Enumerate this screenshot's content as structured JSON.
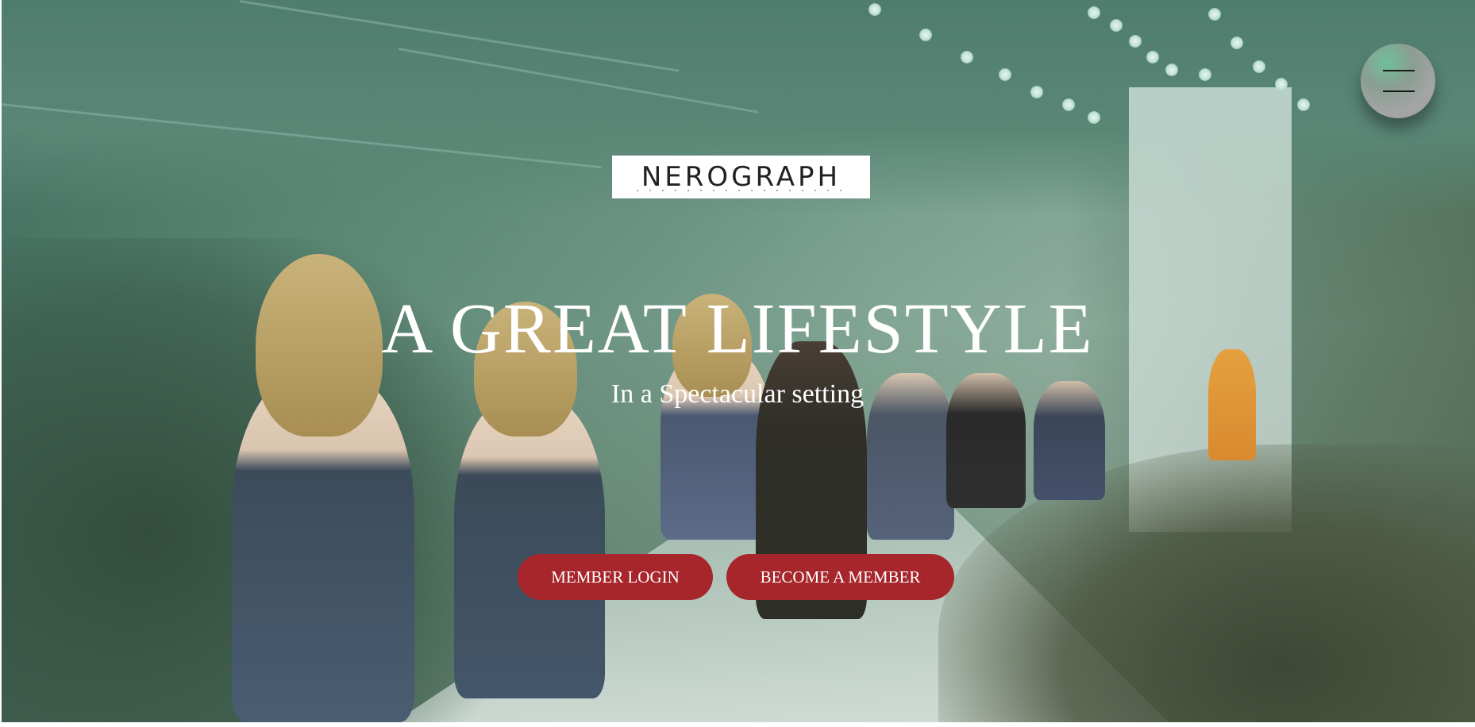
{
  "brand": {
    "logo_text": "NEROGRAPH"
  },
  "hero": {
    "headline": "A GREAT LIFESTYLE",
    "subheadline": "In a Spectacular setting"
  },
  "actions": {
    "member_login_label": "MEMBER LOGIN",
    "become_member_label": "BECOME A MEMBER"
  },
  "menu": {
    "icon": "hamburger-menu-icon"
  },
  "colors": {
    "button_background": "#a7262b",
    "overlay_tint": "#4f7d6d",
    "text": "#ffffff"
  }
}
